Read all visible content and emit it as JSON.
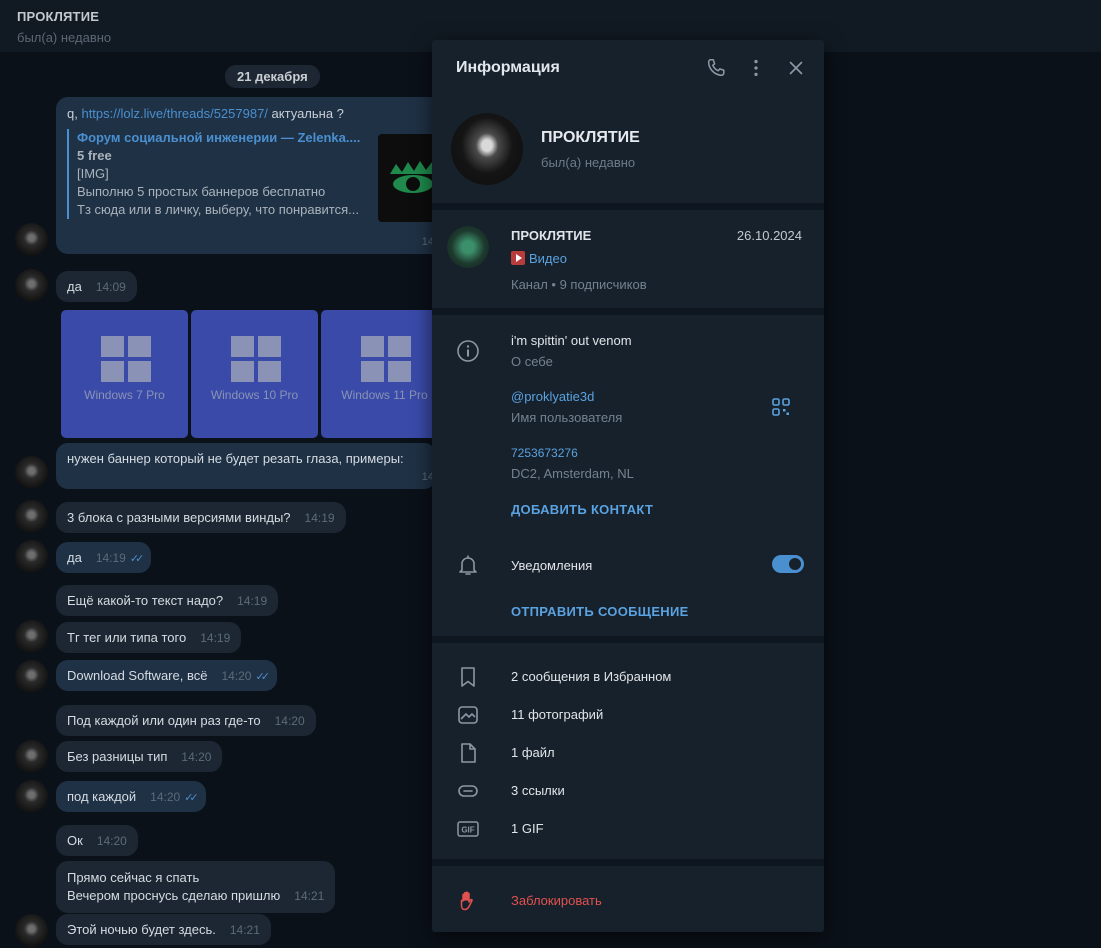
{
  "header": {
    "title": "ПРОКЛЯТИЕ",
    "status": "был(а) недавно"
  },
  "chat": {
    "date": "21 декабря",
    "link_message": {
      "prefix": "q,",
      "url": "https://lolz.live/threads/5257987/",
      "suffix": "актуальна ?",
      "preview_site": "Форум социальной инженерии — Zelenka....",
      "preview_title": "5 free",
      "preview_lines": [
        "[IMG]",
        "Выполню 5 простых баннеров бесплатно",
        "Тз сюда или в личку, выберу, что понравится..."
      ],
      "time": "14"
    },
    "tiles": [
      "Windows 7 Pro",
      "Windows 10 Pro",
      "Windows 11 Pro"
    ],
    "messages": [
      {
        "text": "да",
        "time": "14:09",
        "own": false
      },
      {
        "text": "нужен баннер который не будет резать глаза, примеры:",
        "time": "14",
        "own": true
      },
      {
        "text": "3 блока с разными версиями винды?",
        "time": "14:19",
        "own": false
      },
      {
        "text": "да",
        "time": "14:19",
        "own": true
      },
      {
        "text": "Ещё какой-то текст надо?",
        "time": "14:19",
        "own": false
      },
      {
        "text": "Тг тег или типа того",
        "time": "14:19",
        "own": false
      },
      {
        "text": "Download Software, всё",
        "time": "14:20",
        "own": true
      },
      {
        "text": "Под каждой или один раз где-то",
        "time": "14:20",
        "own": false
      },
      {
        "text": "Без разницы тип",
        "time": "14:20",
        "own": false
      },
      {
        "text": "под каждой",
        "time": "14:20",
        "own": true
      },
      {
        "text": "Ок",
        "time": "14:20",
        "own": false
      },
      {
        "text_lines": [
          "Прямо сейчас я спать",
          "Вечером проснусь сделаю пришлю"
        ],
        "time": "14:21",
        "own": false
      },
      {
        "text": "Этой ночью будет здесь.",
        "time": "14:21",
        "own": false
      }
    ]
  },
  "panel": {
    "title": "Информация",
    "profile": {
      "name": "ПРОКЛЯТИЕ",
      "status": "был(а) недавно"
    },
    "channel": {
      "name": "ПРОКЛЯТИЕ",
      "date": "26.10.2024",
      "video": "Видео",
      "meta": "Канал • 9 подписчиков"
    },
    "bio": {
      "value": "i'm spittin' out venom",
      "label": "О себе"
    },
    "username": {
      "value": "@proklyatie3d",
      "label": "Имя пользователя"
    },
    "phone": {
      "value": "7253673276",
      "label": "DC2, Amsterdam, NL"
    },
    "add_contact": "ДОБАВИТЬ КОНТАКТ",
    "notifications": {
      "label": "Уведомления",
      "enabled": true
    },
    "send_message": "ОТПРАВИТЬ СООБЩЕНИЕ",
    "media": [
      {
        "icon": "bookmark-icon",
        "label": "2 сообщения в Избранном"
      },
      {
        "icon": "photo-icon",
        "label": "11 фотографий"
      },
      {
        "icon": "file-icon",
        "label": "1 файл"
      },
      {
        "icon": "link-icon",
        "label": "3 ссылки"
      },
      {
        "icon": "gif-icon",
        "label": "1 GIF"
      }
    ],
    "block": "Заблокировать"
  },
  "colors": {
    "accent": "#5aa2e0",
    "danger": "#e0514f",
    "panel_bg": "#17212b",
    "chat_bg": "#0b1119"
  }
}
